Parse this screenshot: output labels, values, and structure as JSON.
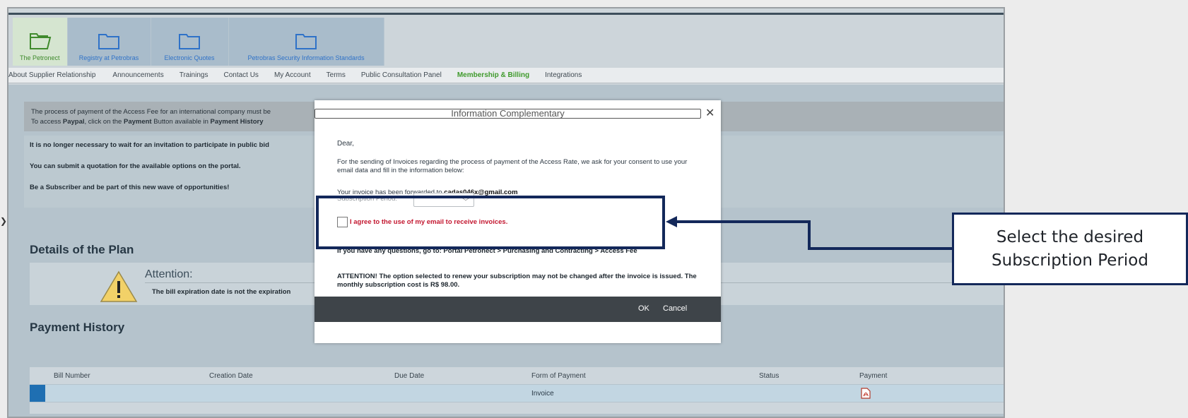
{
  "tabs": [
    {
      "label": "The Petronect",
      "active": true
    },
    {
      "label": "Registry at Petrobras",
      "active": false
    },
    {
      "label": "Electronic Quotes",
      "active": false
    },
    {
      "label": "Petrobras Security Information Standards",
      "active": false
    }
  ],
  "menu": [
    {
      "label": "About Supplier Relationship",
      "active": false
    },
    {
      "label": "Announcements",
      "active": false
    },
    {
      "label": "Trainings",
      "active": false
    },
    {
      "label": "Contact Us",
      "active": false
    },
    {
      "label": "My Account",
      "active": false
    },
    {
      "label": "Terms",
      "active": false
    },
    {
      "label": "Public Consultation Panel",
      "active": false
    },
    {
      "label": "Membership & Billing",
      "active": true
    },
    {
      "label": "Integrations",
      "active": false
    }
  ],
  "notice": {
    "line1": "The process of payment of the Access Fee for an international company must be",
    "line2_pre": "To access ",
    "line2_paypal": "Paypal",
    "line2_mid": ", click on the ",
    "line2_payment": "Payment",
    "line2_mid2": " Button available in ",
    "line2_history": "Payment History",
    "b1": "It is no longer necessary to wait for an invitation to participate in public bid",
    "b2": "You can submit a quotation for the available options on the portal.",
    "b3": "Be a Subscriber and be part of this new wave of opportunities!"
  },
  "plan": {
    "heading": "Details of the Plan",
    "attention_title": "Attention:",
    "attention_text": "The bill expiration date is not the expiration"
  },
  "payment_history": {
    "heading": "Payment History",
    "columns": [
      "Bill Number",
      "Creation Date",
      "Due Date",
      "Form of Payment",
      "Status",
      "Payment"
    ],
    "rows": [
      {
        "bill_number": "",
        "creation_date": "",
        "due_date": "",
        "form_of_payment": "Invoice",
        "status": "",
        "payment_icon": "pdf-icon"
      }
    ]
  },
  "modal": {
    "title": "Information Complementary",
    "dear": "Dear,",
    "p1": "For the sending of Invoices regarding the process of payment of the Access Rate, we ask for your consent to use your email data and fill in the information below:",
    "p2_pre": "Your invoice has been forwarded to ",
    "email": "cadas046x@gmail.com",
    "subscription_label": "Subscription Period:",
    "subscription_value": "",
    "agree": "I agree to the use of my email to receive invoices.",
    "question": "If you have any questions, go to: Portal Petronect > Purchasing and Contracting > Access Fee",
    "attention": "ATTENTION! The option selected to renew your subscription may not be changed after the invoice is issued. The monthly subscription cost is R$ 98.00.",
    "ok": "OK",
    "cancel": "Cancel"
  },
  "callout": {
    "line1": "Select the desired",
    "line2": "Subscription Period"
  },
  "colors": {
    "callout_border": "#13285a",
    "accent_green": "#3f9a2c",
    "tab_blue": "#2f72c8",
    "agree_red": "#c3162f"
  }
}
